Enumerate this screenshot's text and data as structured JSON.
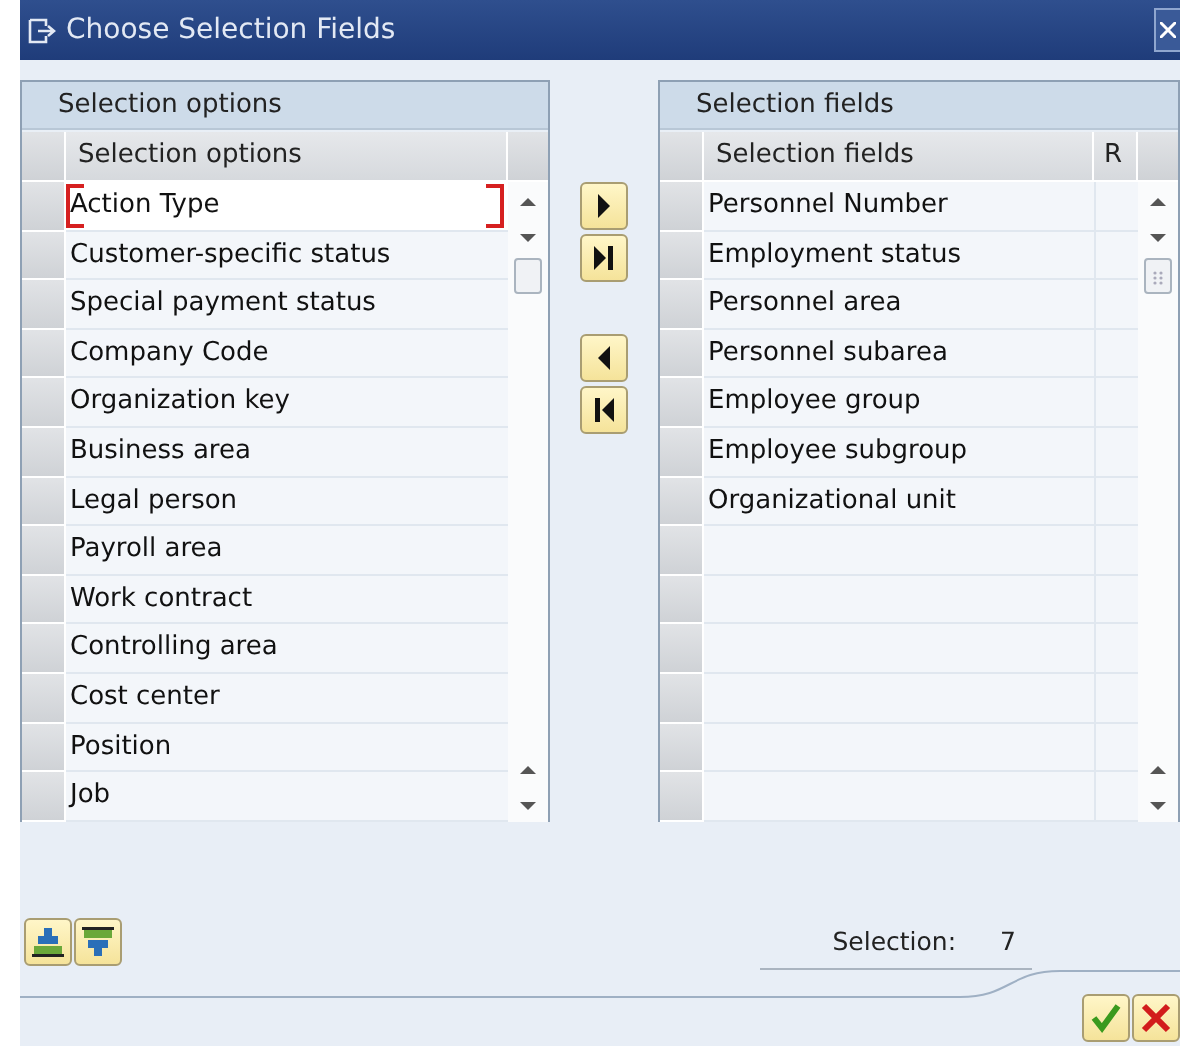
{
  "window": {
    "title": "Choose Selection Fields"
  },
  "available": {
    "title": "Selection options",
    "column": "Selection options",
    "items": [
      {
        "label": "Action Type",
        "focused": true
      },
      {
        "label": "Customer-specific status",
        "focused": false
      },
      {
        "label": "Special payment status",
        "focused": false
      },
      {
        "label": "Company Code",
        "focused": false
      },
      {
        "label": "Organization key",
        "focused": false
      },
      {
        "label": "Business area",
        "focused": false
      },
      {
        "label": "Legal person",
        "focused": false
      },
      {
        "label": "Payroll area",
        "focused": false
      },
      {
        "label": "Work contract",
        "focused": false
      },
      {
        "label": "Controlling area",
        "focused": false
      },
      {
        "label": "Cost center",
        "focused": false
      },
      {
        "label": "Position",
        "focused": false
      },
      {
        "label": "Job",
        "focused": false
      }
    ]
  },
  "chosen": {
    "title": "Selection fields",
    "column": "Selection fields",
    "column_2": "R",
    "items": [
      {
        "label": "Personnel Number",
        "focused": false
      },
      {
        "label": "Employment status",
        "focused": false
      },
      {
        "label": "Personnel area",
        "focused": false
      },
      {
        "label": "Personnel subarea",
        "focused": false
      },
      {
        "label": "Employee group",
        "focused": false
      },
      {
        "label": "Employee subgroup",
        "focused": false
      },
      {
        "label": "Organizational unit",
        "focused": false
      }
    ]
  },
  "selection_count": {
    "label": "Selection:",
    "value": "7"
  }
}
